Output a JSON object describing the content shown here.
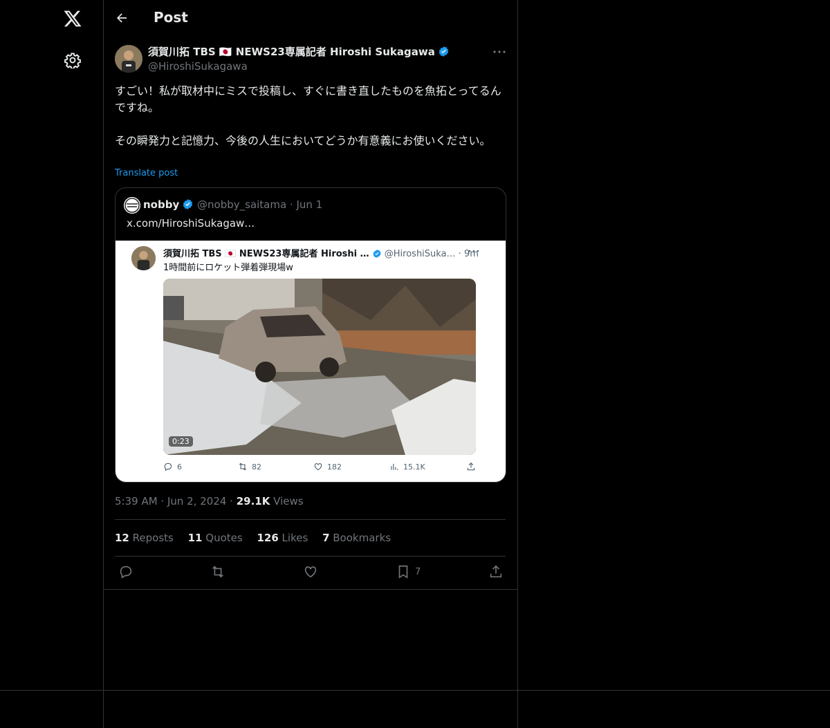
{
  "header": {
    "title": "Post"
  },
  "post": {
    "author_name": "須賀川拓 TBS 🇯🇵 NEWS23専属記者 Hiroshi Sukagawa",
    "handle": "@HiroshiSukagawa",
    "text": "すごい！私が取材中にミスで投稿し、すぐに書き直したものを魚拓とってるんですね。\n\nその瞬発力と記憶力、今後の人生においてどうか有意義にお使いください。",
    "translate_label": "Translate post",
    "timestamp": "5:39 AM · Jun 2, 2024 · ",
    "views_count": "29.1K",
    "views_label": " Views"
  },
  "quote": {
    "name": "nobby",
    "meta": " @nobby_saitama · Jun 1",
    "text": "x.com/HiroshiSukagaw…",
    "screenshot": {
      "name": "須賀川拓 TBS 🇯🇵 NEWS23専属記者 Hiroshi …",
      "meta": " @HiroshiSuka… · 9m",
      "text": "1時間前にロケット弾着弾現場w",
      "duration": "0:23",
      "replies": "6",
      "reposts": "82",
      "likes": "182",
      "views": "15.1K"
    }
  },
  "stats": {
    "reposts_count": "12",
    "reposts_label": " Reposts",
    "quotes_count": "11",
    "quotes_label": " Quotes",
    "likes_count": "126",
    "likes_label": " Likes",
    "bookmarks_count": "7",
    "bookmarks_label": " Bookmarks"
  },
  "actions": {
    "bookmark_count": "7"
  },
  "colors": {
    "background": "#000000",
    "accent": "#1d9bf0",
    "border": "#2f3336",
    "muted": "#71767b"
  }
}
